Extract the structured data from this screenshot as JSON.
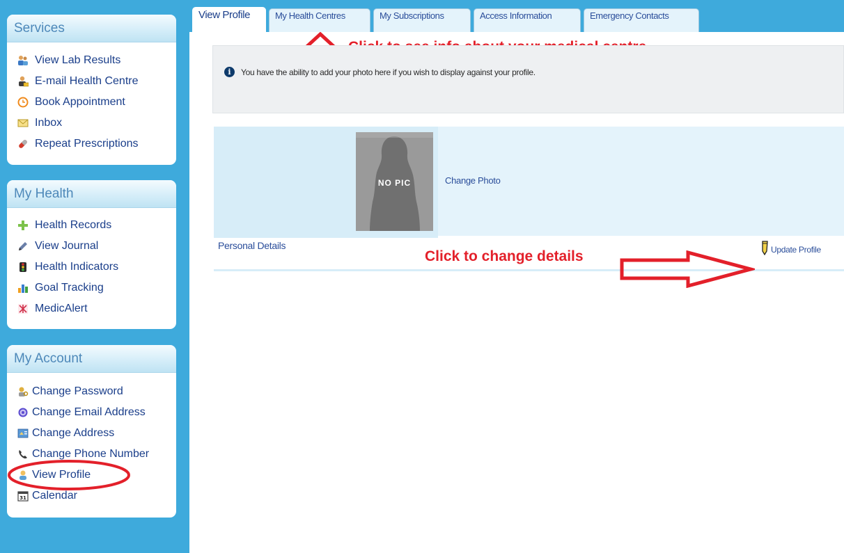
{
  "sidebar": {
    "services": {
      "title": "Services",
      "items": [
        {
          "label": "View Lab Results",
          "icon": "lab-results-icon"
        },
        {
          "label": "E-mail Health Centre",
          "icon": "email-centre-icon"
        },
        {
          "label": "Book Appointment",
          "icon": "clock-icon"
        },
        {
          "label": "Inbox",
          "icon": "envelope-icon"
        },
        {
          "label": "Repeat Prescriptions",
          "icon": "pill-icon"
        }
      ]
    },
    "my_health": {
      "title": "My Health",
      "items": [
        {
          "label": "Health Records",
          "icon": "plus-icon"
        },
        {
          "label": "View Journal",
          "icon": "pencil-icon"
        },
        {
          "label": "Health Indicators",
          "icon": "traffic-light-icon"
        },
        {
          "label": "Goal Tracking",
          "icon": "bar-chart-icon"
        },
        {
          "label": "MedicAlert",
          "icon": "medicalert-icon"
        }
      ]
    },
    "my_account": {
      "title": "My Account",
      "items": [
        {
          "label": "Change Password",
          "icon": "key-user-icon"
        },
        {
          "label": "Change Email Address",
          "icon": "at-sign-icon"
        },
        {
          "label": "Change Address",
          "icon": "address-card-icon"
        },
        {
          "label": "Change Phone Number",
          "icon": "phone-icon"
        },
        {
          "label": "View Profile",
          "icon": "user-icon"
        },
        {
          "label": "Calendar",
          "icon": "calendar-icon"
        }
      ]
    }
  },
  "tabs": [
    {
      "label": "View Profile",
      "active": true
    },
    {
      "label": "My Health Centres"
    },
    {
      "label": "My Subscriptions"
    },
    {
      "label": "Access Information"
    },
    {
      "label": "Emergency Contacts"
    }
  ],
  "info": {
    "text": "You have the ability to add your photo here if you wish to display against your profile.",
    "icon": "info-icon"
  },
  "profile": {
    "photo_placeholder": "NO PIC",
    "change_photo": "Change Photo",
    "personal_details": "Personal Details",
    "update_profile": "Update Profile"
  },
  "annotations": {
    "tab_hint": "Click to see info about your medical centre",
    "details_hint": "Click to change details",
    "color": "#e3202a"
  },
  "colors": {
    "sidebar_bg": "#3eaadc",
    "link": "#1a3e8a",
    "panel_header_text": "#4d88b9",
    "profile_bg": "#d7edf8"
  }
}
